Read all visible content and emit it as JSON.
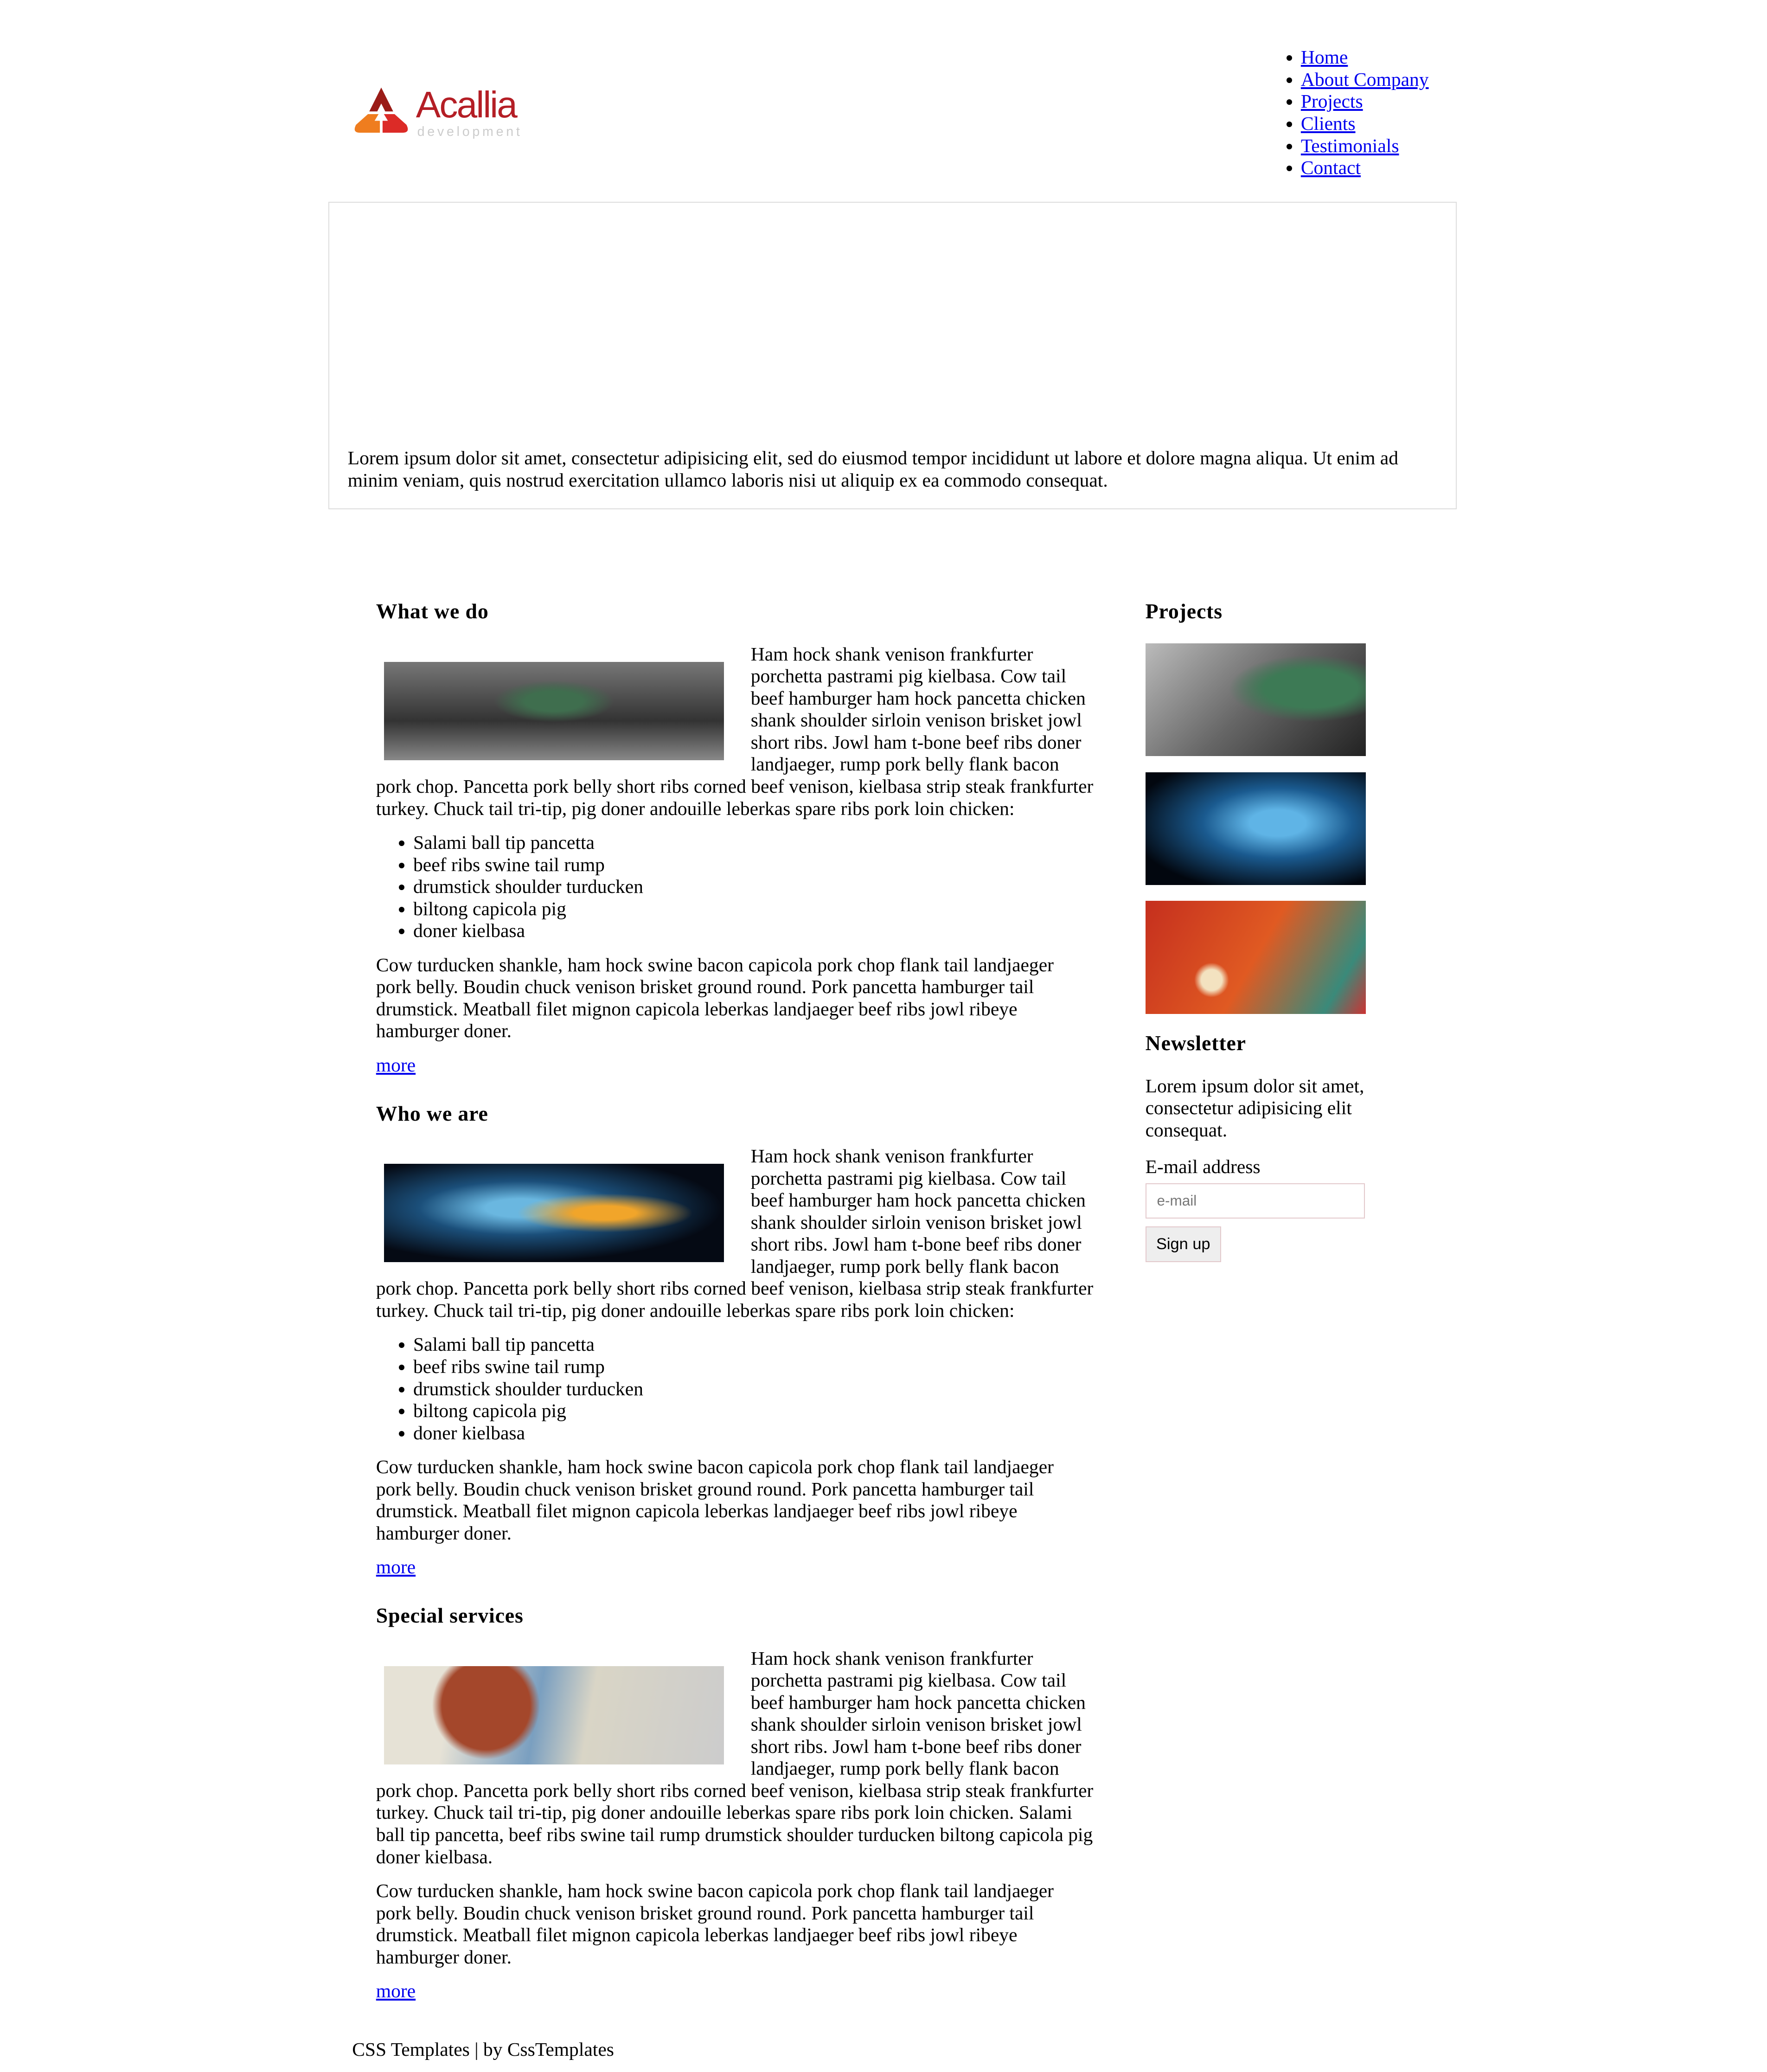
{
  "logo": {
    "name": "Acallia",
    "tagline": "development"
  },
  "nav": [
    "Home",
    "About Company",
    "Projects",
    "Clients",
    "Testimonials",
    "Contact"
  ],
  "hero": {
    "text": "Lorem ipsum dolor sit amet, consectetur adipisicing elit, sed do eiusmod tempor incididunt ut labore et dolore magna aliqua. Ut enim ad minim veniam, quis nostrud exercitation ullamco laboris nisi ut aliquip ex ea commodo consequat."
  },
  "sections": [
    {
      "title": "What we do",
      "p1": "Ham hock shank venison frankfurter porchetta pastrami pig kielbasa. Cow tail beef hamburger ham hock pancetta chicken shank shoulder sirloin venison brisket jowl short ribs. Jowl ham t-bone beef ribs doner landjaeger, rump pork belly flank bacon pork chop. Pancetta pork belly short ribs corned beef venison, kielbasa strip steak frankfurter turkey. Chuck tail tri-tip, pig doner andouille leberkas spare ribs pork loin chicken:",
      "list": [
        "Salami ball tip pancetta",
        "beef ribs swine tail rump",
        "drumstick shoulder turducken",
        "biltong capicola pig",
        "doner kielbasa"
      ],
      "p2": "Cow turducken shankle, ham hock swine bacon capicola pork chop flank tail landjaeger pork belly. Boudin chuck venison brisket ground round. Pork pancetta hamburger tail drumstick. Meatball filet mignon capicola leberkas landjaeger beef ribs jowl ribeye hamburger doner.",
      "more": "more"
    },
    {
      "title": "Who we are",
      "p1": "Ham hock shank venison frankfurter porchetta pastrami pig kielbasa. Cow tail beef hamburger ham hock pancetta chicken shank shoulder sirloin venison brisket jowl short ribs. Jowl ham t-bone beef ribs doner landjaeger, rump pork belly flank bacon pork chop. Pancetta pork belly short ribs corned beef venison, kielbasa strip steak frankfurter turkey. Chuck tail tri-tip, pig doner andouille leberkas spare ribs pork loin chicken:",
      "list": [
        "Salami ball tip pancetta",
        "beef ribs swine tail rump",
        "drumstick shoulder turducken",
        "biltong capicola pig",
        "doner kielbasa"
      ],
      "p2": "Cow turducken shankle, ham hock swine bacon capicola pork chop flank tail landjaeger pork belly. Boudin chuck venison brisket ground round. Pork pancetta hamburger tail drumstick. Meatball filet mignon capicola leberkas landjaeger beef ribs jowl ribeye hamburger doner.",
      "more": "more"
    },
    {
      "title": "Special services",
      "p1": "Ham hock shank venison frankfurter porchetta pastrami pig kielbasa. Cow tail beef hamburger ham hock pancetta chicken shank shoulder sirloin venison brisket jowl short ribs. Jowl ham t-bone beef ribs doner landjaeger, rump pork belly flank bacon pork chop. Pancetta pork belly short ribs corned beef venison, kielbasa strip steak frankfurter turkey. Chuck tail tri-tip, pig doner andouille leberkas spare ribs pork loin chicken. Salami ball tip pancetta, beef ribs swine tail rump drumstick shoulder turducken biltong capicola pig doner kielbasa.",
      "p2": "Cow turducken shankle, ham hock swine bacon capicola pork chop flank tail landjaeger pork belly. Boudin chuck venison brisket ground round. Pork pancetta hamburger tail drumstick. Meatball filet mignon capicola leberkas landjaeger beef ribs jowl ribeye hamburger doner.",
      "more": "more"
    }
  ],
  "sidebar": {
    "projects_title": "Projects",
    "newsletter_title": "Newsletter",
    "newsletter_text": "Lorem ipsum dolor sit amet, consectetur adipisicing elit consequat.",
    "email_label": "E-mail address",
    "email_placeholder": "e-mail",
    "signup": "Sign up"
  },
  "footer": "CSS Templates | by CssTemplates",
  "colors": {
    "brand": "#b41e25",
    "link": "#0000ee"
  }
}
